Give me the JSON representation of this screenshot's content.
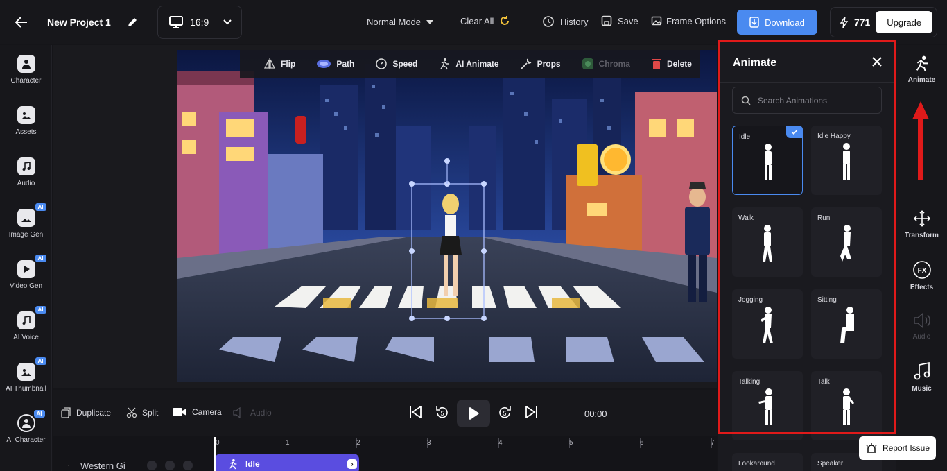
{
  "header": {
    "project_title": "New Project 1",
    "aspect_ratio": "16:9",
    "mode": "Normal Mode",
    "clear_all": "Clear All",
    "history": "History",
    "save": "Save",
    "frame_options": "Frame Options",
    "download": "Download",
    "credits": "771",
    "upgrade": "Upgrade"
  },
  "left_sidebar": {
    "items": [
      {
        "label": "Character",
        "icon": "character-icon",
        "ai": false
      },
      {
        "label": "Assets",
        "icon": "assets-icon",
        "ai": false
      },
      {
        "label": "Audio",
        "icon": "music-note-icon",
        "ai": false
      },
      {
        "label": "Image Gen",
        "icon": "image-gen-icon",
        "ai": true
      },
      {
        "label": "Video Gen",
        "icon": "video-gen-icon",
        "ai": true
      },
      {
        "label": "AI Voice",
        "icon": "ai-voice-icon",
        "ai": true
      },
      {
        "label": "AI Thumbnail",
        "icon": "ai-thumbnail-icon",
        "ai": true
      },
      {
        "label": "AI Character",
        "icon": "ai-character-icon",
        "ai": true
      }
    ],
    "ai_badge": "AI"
  },
  "canvas_toolbar": {
    "flip": "Flip",
    "path": "Path",
    "speed": "Speed",
    "ai_animate": "AI Animate",
    "props": "Props",
    "chroma": "Chroma",
    "delete": "Delete"
  },
  "timeline_controls": {
    "duplicate": "Duplicate",
    "split": "Split",
    "camera": "Camera",
    "audio": "Audio",
    "rewind_seconds": "5",
    "forward_seconds": "5",
    "timecode": "00:00"
  },
  "timeline": {
    "ruler": [
      "0",
      "1",
      "2",
      "3",
      "4",
      "5",
      "6",
      "7"
    ],
    "track_name": "Western Gi",
    "clip_label": "Idle"
  },
  "animate_panel": {
    "title": "Animate",
    "search_placeholder": "Search Animations",
    "animations": [
      {
        "name": "Idle",
        "selected": true
      },
      {
        "name": "Idle Happy",
        "selected": false
      },
      {
        "name": "Walk",
        "selected": false
      },
      {
        "name": "Run",
        "selected": false
      },
      {
        "name": "Jogging",
        "selected": false
      },
      {
        "name": "Sitting",
        "selected": false
      },
      {
        "name": "Talking",
        "selected": false
      },
      {
        "name": "Talk",
        "selected": false
      },
      {
        "name": "Lookaround",
        "selected": false
      },
      {
        "name": "Speaker",
        "selected": false
      }
    ]
  },
  "right_sidebar": {
    "items": [
      {
        "label": "Animate",
        "icon": "running-figure-icon",
        "active": true,
        "disabled": false
      },
      {
        "label": "Transform",
        "icon": "move-arrows-icon",
        "active": false,
        "disabled": false
      },
      {
        "label": "Effects",
        "icon": "fx-icon",
        "active": false,
        "disabled": false
      },
      {
        "label": "Audio",
        "icon": "speaker-icon",
        "active": false,
        "disabled": true
      },
      {
        "label": "Music",
        "icon": "music-note-icon",
        "active": false,
        "disabled": false
      }
    ]
  },
  "report_issue": "Report Issue",
  "colors": {
    "accent": "#4a8af0",
    "highlight_box": "#e01a1a",
    "background": "#151519"
  }
}
